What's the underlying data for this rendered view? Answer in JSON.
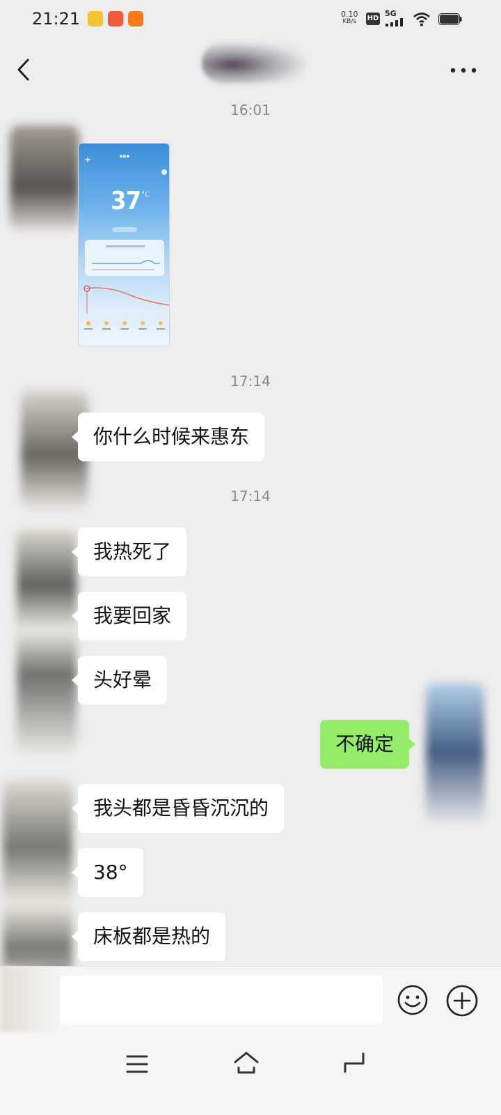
{
  "status_bar": {
    "time": "21:21",
    "net_speed_value": "0.10",
    "net_speed_unit": "KB/s",
    "hd_label": "HD",
    "network_label": "5G"
  },
  "header": {
    "back_icon": "chevron-left-icon",
    "more_icon": "more-dots-icon"
  },
  "messages": {
    "timestamps": [
      "16:01",
      "17:14",
      "17:14"
    ],
    "image_message": {
      "temperature": "37",
      "temp_unit": "°C"
    },
    "texts": [
      {
        "side": "left",
        "text": "你什么时候来惠东"
      },
      {
        "side": "left",
        "text": "我热死了"
      },
      {
        "side": "left",
        "text": "我要回家"
      },
      {
        "side": "left",
        "text": "头好晕"
      },
      {
        "side": "right",
        "text": "不确定"
      },
      {
        "side": "left",
        "text": "我头都是昏昏沉沉的"
      },
      {
        "side": "left",
        "text": "38°"
      },
      {
        "side": "left",
        "text": "床板都是热的"
      }
    ]
  },
  "input_bar": {
    "emoji_icon": "smiley-icon",
    "plus_icon": "plus-circle-icon"
  },
  "system_nav": {
    "menu_icon": "menu-lines-icon",
    "home_icon": "home-icon",
    "back_icon": "back-arrow-icon"
  },
  "colors": {
    "background": "#ededed",
    "bubble_received": "#ffffff",
    "bubble_sent": "#95ec69"
  }
}
